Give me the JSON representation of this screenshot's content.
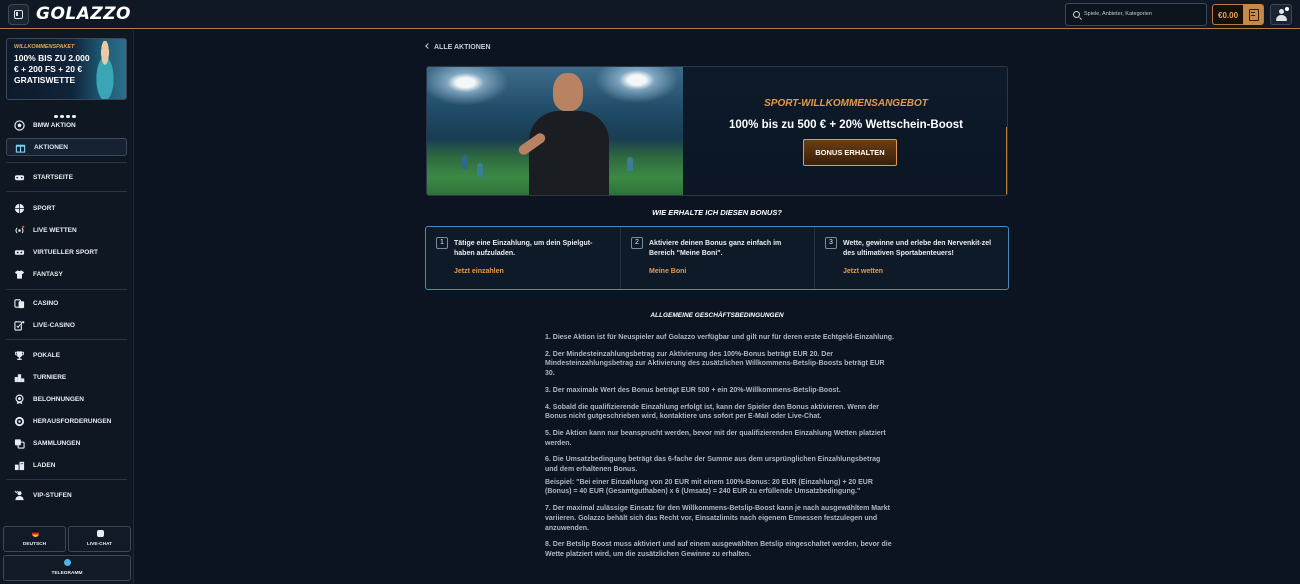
{
  "header": {
    "logo": "GOLAZZO",
    "search_placeholder": "Spiele, Anbieter, Kategorien",
    "balance": "€0.00"
  },
  "sidebar": {
    "promo": {
      "tag": "WILLKOMMENSPAKET",
      "text": "100% BIS ZU 2.000 € + 200 FS + 20 € GRATISWETTE"
    },
    "items": [
      {
        "label": "BMW AKTION",
        "icon": "soccer-ball-icon"
      },
      {
        "label": "AKTIONEN",
        "icon": "gift-icon"
      },
      {
        "label": "STARTSEITE",
        "icon": "controller-icon"
      },
      {
        "label": "SPORT",
        "icon": "ball-icon"
      },
      {
        "label": "LIVE WETTEN",
        "icon": "live-signal-icon"
      },
      {
        "label": "VIRTUELLER SPORT",
        "icon": "vr-icon"
      },
      {
        "label": "FANTASY",
        "icon": "shirt-icon"
      },
      {
        "label": "CASINO",
        "icon": "cards-icon"
      },
      {
        "label": "LIVE-CASINO",
        "icon": "live-dealer-icon"
      },
      {
        "label": "POKALE",
        "icon": "trophy-icon"
      },
      {
        "label": "TURNIERE",
        "icon": "podium-icon"
      },
      {
        "label": "BELOHNUNGEN",
        "icon": "medal-icon"
      },
      {
        "label": "HERAUSFORDERUNGEN",
        "icon": "target-icon"
      },
      {
        "label": "SAMMLUNGEN",
        "icon": "collection-icon"
      },
      {
        "label": "LADEN",
        "icon": "store-icon"
      },
      {
        "label": "VIP-STUFEN",
        "icon": "vip-icon"
      }
    ],
    "bottom": {
      "language": "DEUTSCH",
      "chat": "LIVE-CHAT",
      "telegram": "TELEGRAMM"
    }
  },
  "main": {
    "back_label": "ALLE AKTIONEN",
    "hero": {
      "tag": "SPORT-WILLKOMMENSANGEBOT",
      "title": "100% bis zu 500 € + 20% Wettschein-Boost",
      "button": "BONUS ERHALTEN"
    },
    "how_title": "WIE ERHALTE ICH DIESEN BONUS?",
    "steps": [
      {
        "num": "1",
        "text": "Tätige eine Einzahlung, um dein Spielgut-haben aufzuladen.",
        "link": "Jetzt einzahlen"
      },
      {
        "num": "2",
        "text": "Aktiviere deinen Bonus ganz einfach im Bereich \"Meine Boni\".",
        "link": "Meine Boni"
      },
      {
        "num": "3",
        "text": "Wette, gewinne und erlebe den Nervenkit-zel des ultimativen Sportabenteuers!",
        "link": "Jetzt wetten"
      }
    ],
    "terms_title": "ALLGEMEINE GESCHÄFTSBEDINGUNGEN",
    "terms": [
      "1. Diese Aktion ist für Neuspieler auf Golazzo verfügbar und gilt nur für deren erste Echtgeld-Einzahlung.",
      "2. Der Mindesteinzahlungsbetrag zur Aktivierung des 100%-Bonus beträgt EUR 20. Der Mindesteinzahlungsbetrag zur Aktivierung des zusätzlichen Willkommens-Betslip-Boosts beträgt EUR 30.",
      "3. Der maximale Wert des Bonus beträgt EUR 500 + ein 20%-Willkommens-Betslip-Boost.",
      "4. Sobald die qualifizierende Einzahlung erfolgt ist, kann der Spieler den Bonus aktivieren. Wenn der Bonus nicht gutgeschrieben wird, kontaktiere uns sofort per E-Mail oder Live-Chat.",
      "5. Die Aktion kann nur beansprucht werden, bevor mit der qualifizierenden Einzahlung Wetten platziert werden.",
      "6. Die Umsatzbedingung beträgt das 6-fache der Summe aus dem ursprünglichen Einzahlungsbetrag und dem erhaltenen Bonus.",
      "Beispiel: \"Bei einer Einzahlung von 20 EUR mit einem 100%-Bonus: 20 EUR (Einzahlung) + 20 EUR (Bonus) = 40 EUR (Gesamtguthaben) x 6 (Umsatz) = 240 EUR zu erfüllende Umsatzbedingung.\"",
      "7. Der maximal zulässige Einsatz für den Willkommens-Betslip-Boost kann je nach ausgewähltem Markt variieren. Golazzo behält sich das Recht vor, Einsatzlimits nach eigenem Ermessen festzulegen und anzuwenden.",
      "8. Der Betslip Boost muss aktiviert und auf einem ausgewählten Betslip eingeschaltet werden, bevor die Wette platziert wird, um die zusätzlichen Gewinne zu erhalten."
    ]
  },
  "colors": {
    "accent": "#e29a4f",
    "background": "#0b1420",
    "step_border": "#4a88b8"
  }
}
